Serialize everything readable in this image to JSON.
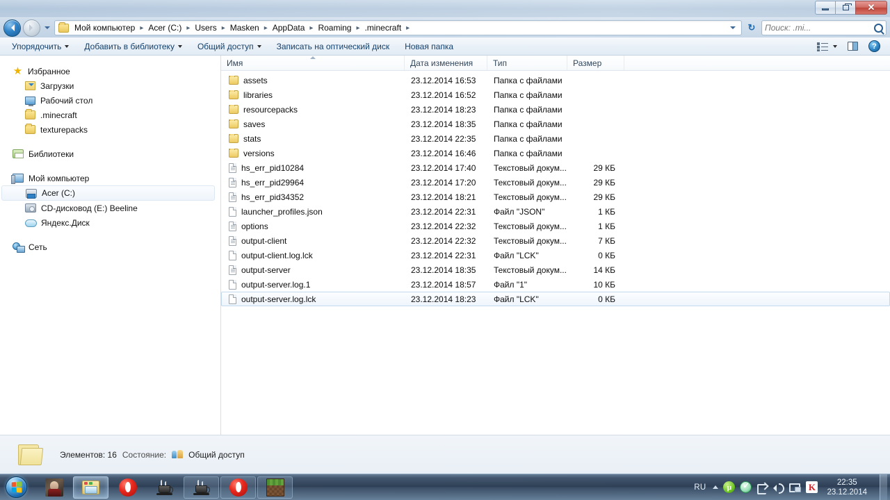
{
  "window": {
    "controls": {
      "minimize": "–",
      "restore": "❐",
      "close": "✕"
    }
  },
  "address": {
    "back_title": "Назад",
    "forward_title": "Вперёд",
    "recent_title": "Последние страницы",
    "refresh": "↻",
    "breadcrumbs": [
      "Мой компьютер",
      "Acer (C:)",
      "Users",
      "Masken",
      "AppData",
      "Roaming",
      ".minecraft"
    ],
    "separator": "▸"
  },
  "search": {
    "placeholder": "Поиск: .mi...",
    "value": ""
  },
  "toolbar": {
    "items": [
      {
        "label": "Упорядочить",
        "has_menu": true
      },
      {
        "label": "Добавить в библиотеку",
        "has_menu": true
      },
      {
        "label": "Общий доступ",
        "has_menu": true
      },
      {
        "label": "Записать на оптический диск",
        "has_menu": false
      },
      {
        "label": "Новая папка",
        "has_menu": false
      }
    ],
    "view_label": "Изменить представление",
    "preview_label": "Область просмотра",
    "help_label": "?"
  },
  "sidebar": {
    "groups": [
      {
        "header": {
          "label": "Избранное",
          "icon": "star-icon"
        },
        "items": [
          {
            "label": "Загрузки",
            "icon": "downloads-folder-icon",
            "selected": false
          },
          {
            "label": "Рабочий стол",
            "icon": "desktop-icon",
            "selected": false
          },
          {
            "label": ".minecraft",
            "icon": "folder-icon",
            "selected": false
          },
          {
            "label": "texturepacks",
            "icon": "folder-icon",
            "selected": false
          }
        ]
      },
      {
        "header": {
          "label": "Библиотеки",
          "icon": "libraries-icon"
        },
        "items": []
      },
      {
        "header": {
          "label": "Мой компьютер",
          "icon": "computer-icon"
        },
        "items": [
          {
            "label": "Acer (C:)",
            "icon": "harddisk-icon",
            "selected": true
          },
          {
            "label": "CD-дисковод (E:) Beeline",
            "icon": "cd-drive-icon",
            "selected": false
          },
          {
            "label": "Яндекс.Диск",
            "icon": "yandex-disk-icon",
            "selected": false
          }
        ]
      },
      {
        "header": {
          "label": "Сеть",
          "icon": "network-icon"
        },
        "items": []
      }
    ]
  },
  "filelist": {
    "columns": [
      {
        "key": "name",
        "label": "Имя",
        "sorted": true,
        "sort_dir": "asc"
      },
      {
        "key": "date",
        "label": "Дата изменения",
        "sorted": false
      },
      {
        "key": "type",
        "label": "Тип",
        "sorted": false
      },
      {
        "key": "size",
        "label": "Размер",
        "sorted": false
      }
    ],
    "rows": [
      {
        "name": "assets",
        "date": "23.12.2014 16:53",
        "type": "Папка с файлами",
        "size": "",
        "icon": "folder-icon",
        "selected": false
      },
      {
        "name": "libraries",
        "date": "23.12.2014 16:52",
        "type": "Папка с файлами",
        "size": "",
        "icon": "folder-icon",
        "selected": false
      },
      {
        "name": "resourcepacks",
        "date": "23.12.2014 18:23",
        "type": "Папка с файлами",
        "size": "",
        "icon": "folder-icon",
        "selected": false
      },
      {
        "name": "saves",
        "date": "23.12.2014 18:35",
        "type": "Папка с файлами",
        "size": "",
        "icon": "folder-icon",
        "selected": false
      },
      {
        "name": "stats",
        "date": "23.12.2014 22:35",
        "type": "Папка с файлами",
        "size": "",
        "icon": "folder-icon",
        "selected": false
      },
      {
        "name": "versions",
        "date": "23.12.2014 16:46",
        "type": "Папка с файлами",
        "size": "",
        "icon": "folder-icon",
        "selected": false
      },
      {
        "name": "hs_err_pid10284",
        "date": "23.12.2014 17:40",
        "type": "Текстовый докум...",
        "size": "29 КБ",
        "icon": "text-file-icon",
        "selected": false
      },
      {
        "name": "hs_err_pid29964",
        "date": "23.12.2014 17:20",
        "type": "Текстовый докум...",
        "size": "29 КБ",
        "icon": "text-file-icon",
        "selected": false
      },
      {
        "name": "hs_err_pid34352",
        "date": "23.12.2014 18:21",
        "type": "Текстовый докум...",
        "size": "29 КБ",
        "icon": "text-file-icon",
        "selected": false
      },
      {
        "name": "launcher_profiles.json",
        "date": "23.12.2014 22:31",
        "type": "Файл \"JSON\"",
        "size": "1 КБ",
        "icon": "generic-file-icon",
        "selected": false
      },
      {
        "name": "options",
        "date": "23.12.2014 22:32",
        "type": "Текстовый докум...",
        "size": "1 КБ",
        "icon": "text-file-icon",
        "selected": false
      },
      {
        "name": "output-client",
        "date": "23.12.2014 22:32",
        "type": "Текстовый докум...",
        "size": "7 КБ",
        "icon": "text-file-icon",
        "selected": false
      },
      {
        "name": "output-client.log.lck",
        "date": "23.12.2014 22:31",
        "type": "Файл \"LCK\"",
        "size": "0 КБ",
        "icon": "generic-file-icon",
        "selected": false
      },
      {
        "name": "output-server",
        "date": "23.12.2014 18:35",
        "type": "Текстовый докум...",
        "size": "14 КБ",
        "icon": "text-file-icon",
        "selected": false
      },
      {
        "name": "output-server.log.1",
        "date": "23.12.2014 18:57",
        "type": "Файл \"1\"",
        "size": "10 КБ",
        "icon": "generic-file-icon",
        "selected": false
      },
      {
        "name": "output-server.log.lck",
        "date": "23.12.2014 18:23",
        "type": "Файл \"LCK\"",
        "size": "0 КБ",
        "icon": "generic-file-icon",
        "selected": true
      }
    ]
  },
  "statusbar": {
    "items_label": "Элементов: 16",
    "state_label": "Состояние:",
    "state_value": "Общий доступ"
  },
  "taskbar": {
    "start_label": "Пуск",
    "buttons": [
      {
        "name": "game-app",
        "icon": "game-icon",
        "state": "running"
      },
      {
        "name": "explorer",
        "icon": "explorer-icon",
        "state": "active"
      },
      {
        "name": "opera-1",
        "icon": "opera-icon",
        "state": "running"
      },
      {
        "name": "java-1",
        "icon": "java-icon",
        "state": "running"
      },
      {
        "name": "java-2",
        "icon": "java-icon",
        "state": "pinned"
      },
      {
        "name": "opera-2",
        "icon": "opera-icon",
        "state": "pinned"
      },
      {
        "name": "minecraft",
        "icon": "minecraft-icon",
        "state": "pinned"
      }
    ],
    "tray": {
      "language": "RU",
      "icons": [
        {
          "name": "utorrent-icon",
          "glyph": "µ"
        },
        {
          "name": "yandex-disk-icon",
          "glyph": ""
        },
        {
          "name": "safely-remove-icon",
          "glyph": ""
        },
        {
          "name": "volume-icon",
          "glyph": ""
        },
        {
          "name": "network-icon",
          "glyph": ""
        },
        {
          "name": "kaspersky-icon",
          "glyph": "K"
        }
      ],
      "clock_time": "22:35",
      "clock_date": "23.12.2014"
    }
  },
  "colors": {
    "accent": "#2f83c8",
    "close_button": "#bd453a",
    "folder": "#f3d778",
    "selection": "#eef5fc",
    "taskbar": "#283a50"
  }
}
